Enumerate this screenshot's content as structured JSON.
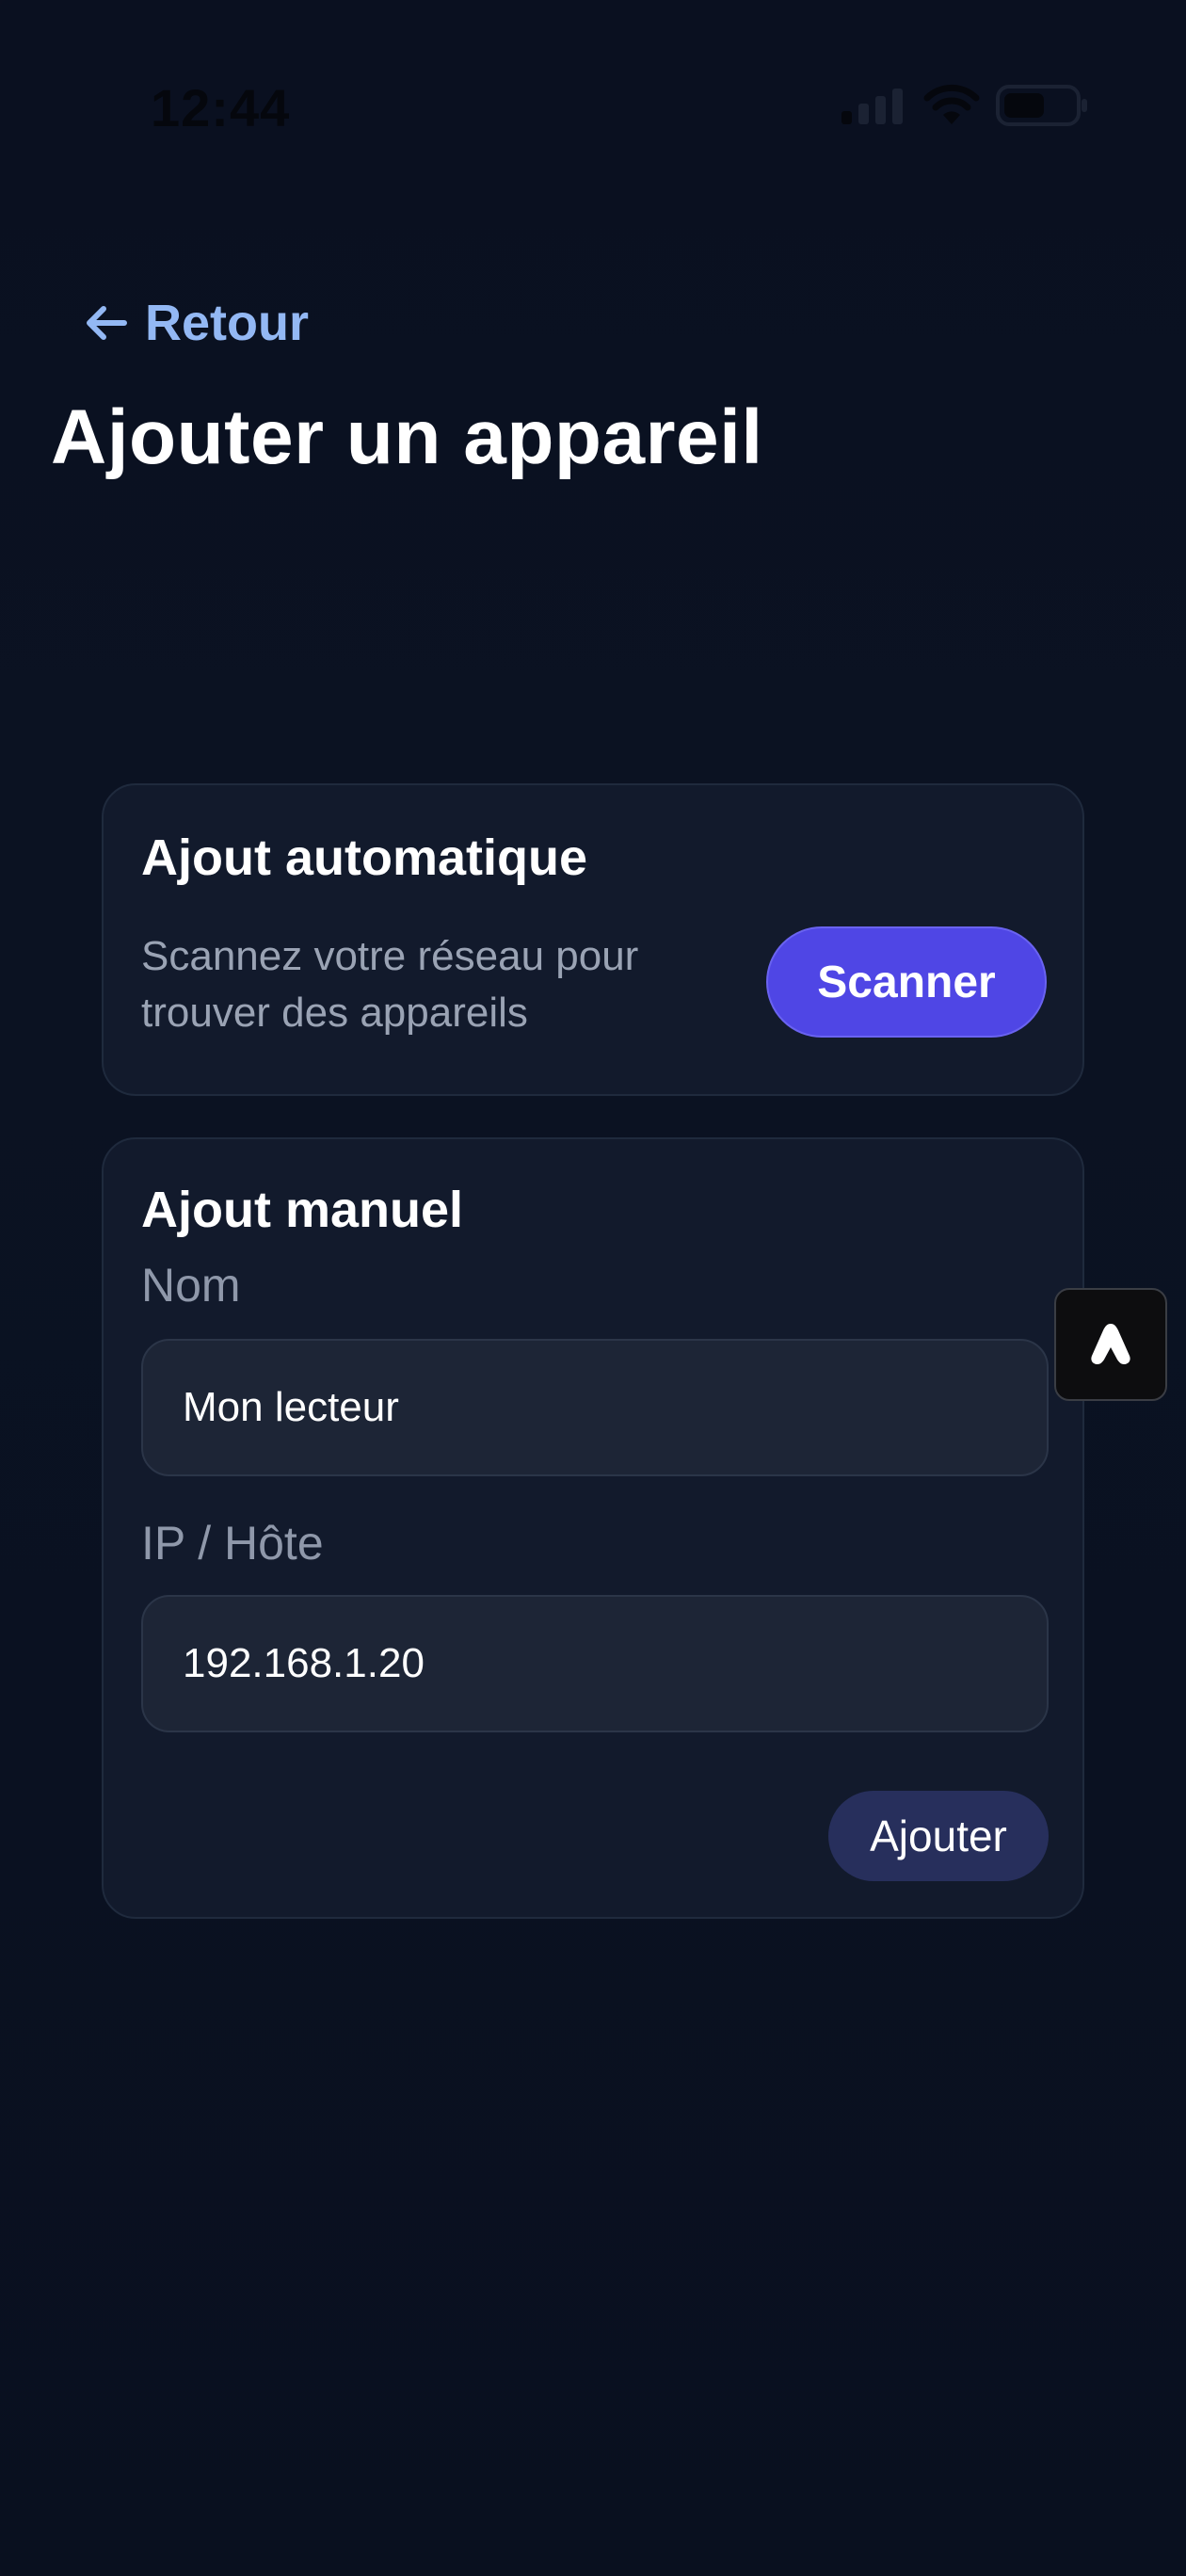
{
  "status_bar": {
    "time": "12:44"
  },
  "header": {
    "back_label": "Retour",
    "title": "Ajouter un appareil"
  },
  "auto_add": {
    "title": "Ajout automatique",
    "description": "Scannez votre réseau pour trouver des appareils",
    "scan_button": "Scanner"
  },
  "manual_add": {
    "title": "Ajout manuel",
    "name_label": "Nom",
    "name_value": "Mon lecteur",
    "ip_label": "IP / Hôte",
    "ip_value": "192.168.1.20",
    "add_button": "Ajouter"
  },
  "icons": {
    "back": "arrow-left-icon",
    "signal": "cellular-signal-icon",
    "wifi": "wifi-icon",
    "battery": "battery-icon",
    "fab": "assistant-a-icon"
  },
  "colors": {
    "background": "#0b1020",
    "card": "#121a2c",
    "accent": "#4f46e5",
    "link": "#93b8f4",
    "secondary_button": "#272f5c",
    "muted_text": "#9aa3b4"
  }
}
